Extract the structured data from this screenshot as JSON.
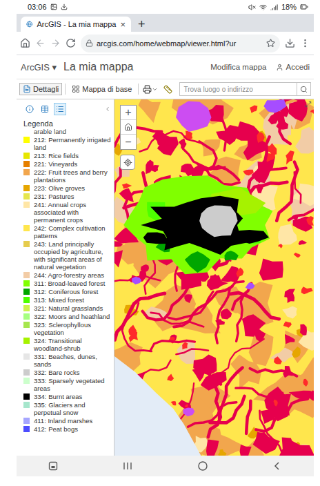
{
  "status_bar": {
    "time": "03:06",
    "battery": "18%"
  },
  "browser": {
    "tab": {
      "title": "ArcGIS - La mia mappa",
      "close": "×",
      "selected": true
    },
    "new_tab": "+",
    "url": "arcgis.com/home/webmap/viewer.html?ur"
  },
  "app_header": {
    "logo": "ArcGIS",
    "logo_caret": "▾",
    "title": "La mia mappa",
    "links": [
      "Modifica mappa",
      "Accedi"
    ]
  },
  "toolbar": {
    "tabs": [
      {
        "label": "Dettagli",
        "kind": "details",
        "selected": true
      },
      {
        "label": "Mappa di base",
        "kind": "basemap",
        "selected": false
      }
    ],
    "search": {
      "placeholder": "Trova luogo o indirizzo"
    }
  },
  "panel": {
    "tabs": [
      {
        "kind": "about",
        "selected": false
      },
      {
        "kind": "content",
        "selected": false
      },
      {
        "kind": "legend",
        "selected": true
      }
    ],
    "legend": {
      "title": "Legenda",
      "cut_label": "arable land",
      "items": [
        {
          "label": "212: Permanently irrigated land",
          "color": "#ffff00"
        },
        {
          "label": "213: Rice fields",
          "color": "#e6e600"
        },
        {
          "label": "221: Vineyards",
          "color": "#e68000"
        },
        {
          "label": "222: Fruit trees and berry plantations",
          "color": "#f2a64d"
        },
        {
          "label": "223: Olive groves",
          "color": "#e6a600"
        },
        {
          "label": "231: Pastures",
          "color": "#e6e64d"
        },
        {
          "label": "241: Annual crops associated with permanent crops",
          "color": "#ffe6a6"
        },
        {
          "label": "242: Complex cultivation patterns",
          "color": "#ffe64d"
        },
        {
          "label": "243: Land principally occupied by agriculture, with significant areas of natural vegetation",
          "color": "#e6cc4d"
        },
        {
          "label": "244: Agro-forestry areas",
          "color": "#f2cca6"
        },
        {
          "label": "311: Broad-leaved forest",
          "color": "#80ff00"
        },
        {
          "label": "312: Coniferous forest",
          "color": "#00a600"
        },
        {
          "label": "313: Mixed forest",
          "color": "#4dff00"
        },
        {
          "label": "321: Natural grasslands",
          "color": "#ccf24d"
        },
        {
          "label": "322: Moors and heathland",
          "color": "#a6ff80"
        },
        {
          "label": "323: Sclerophyllous vegetation",
          "color": "#a6e64d"
        },
        {
          "label": "324: Transitional woodland-shrub",
          "color": "#a6f200"
        },
        {
          "label": "331: Beaches, dunes, sands",
          "color": "#e6e6e6"
        },
        {
          "label": "332: Bare rocks",
          "color": "#cccccc"
        },
        {
          "label": "333: Sparsely vegetated areas",
          "color": "#ccffcc"
        },
        {
          "label": "334: Burnt areas",
          "color": "#000000"
        },
        {
          "label": "335: Glaciers and perpetual snow",
          "color": "#a6e6cc"
        },
        {
          "label": "411: Inland marshes",
          "color": "#a6a6ff"
        },
        {
          "label": "412: Peat bogs",
          "color": "#4d4dff"
        }
      ]
    }
  },
  "map": {
    "zoom_in": "+",
    "zoom_out": "−"
  }
}
